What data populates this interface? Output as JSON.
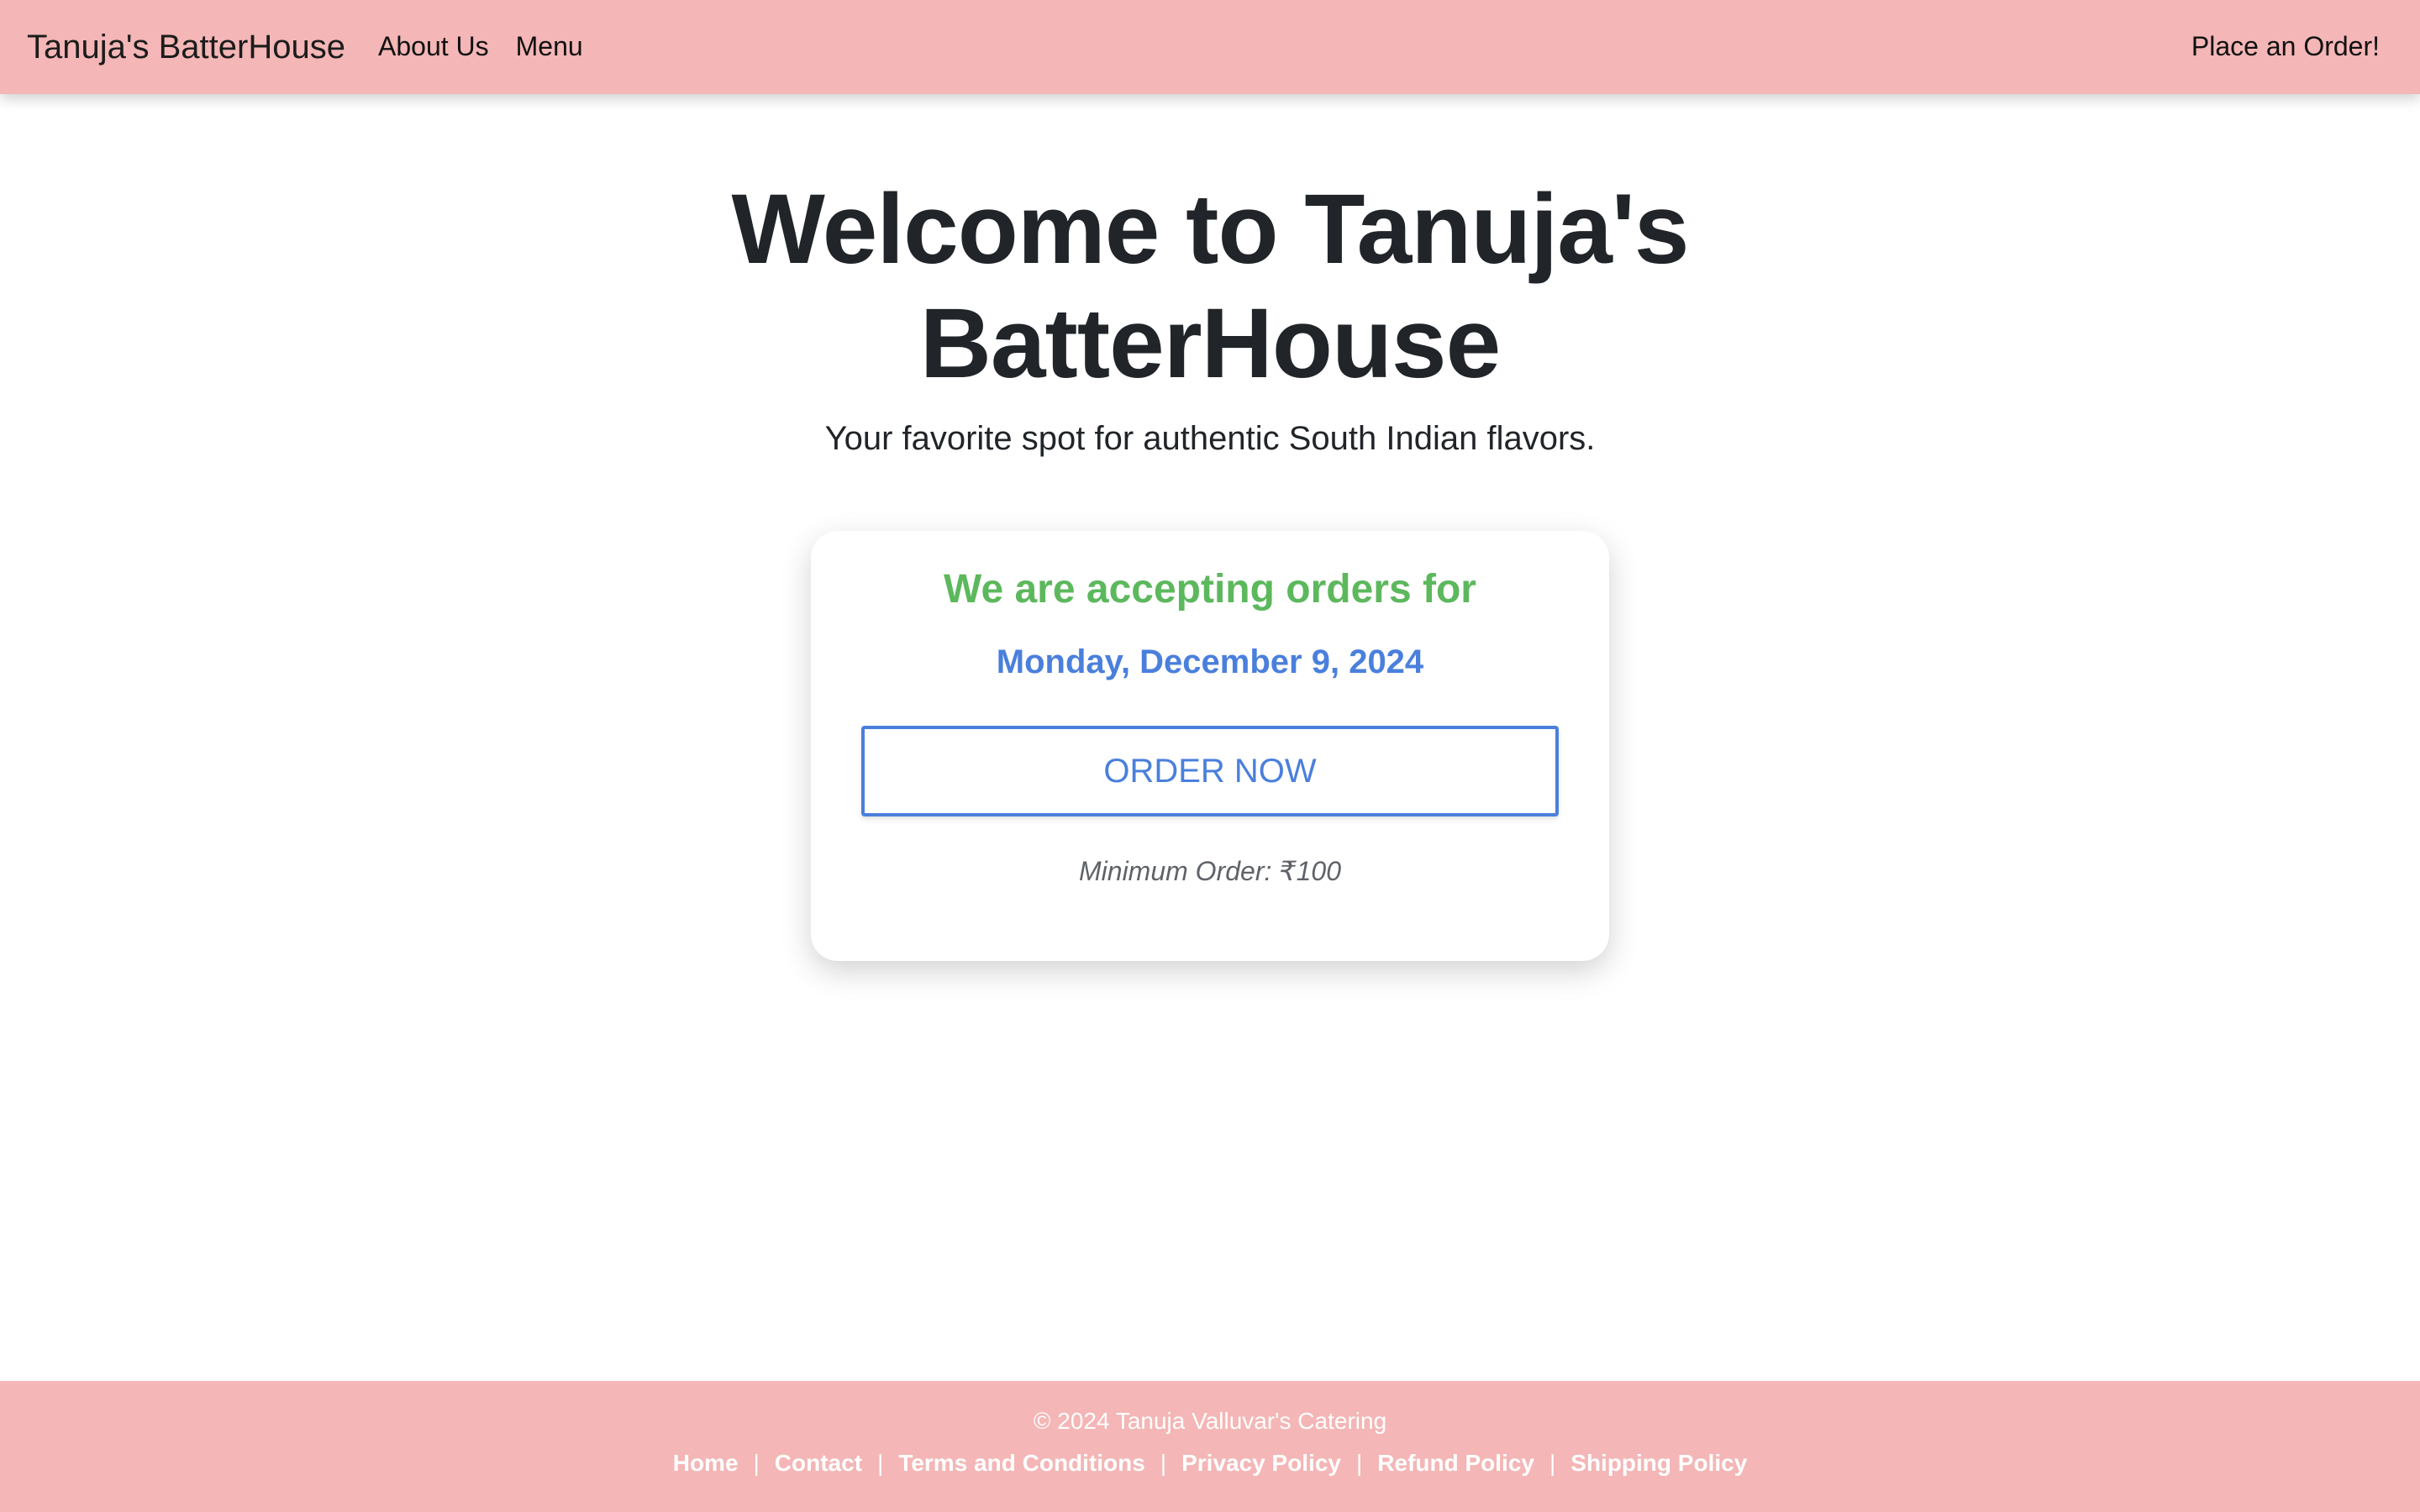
{
  "navbar": {
    "brand": "Tanuja's BatterHouse",
    "links": [
      {
        "label": "About Us"
      },
      {
        "label": "Menu"
      }
    ],
    "order_link": "Place an Order!"
  },
  "hero": {
    "title_line1": "Welcome to Tanuja's",
    "title_line2": "BatterHouse",
    "subtitle": "Your favorite spot for authentic South Indian flavors."
  },
  "order_card": {
    "heading": "We are accepting orders for",
    "date": "Monday, December 9, 2024",
    "button_label": "ORDER NOW",
    "minimum_order": "Minimum Order: ₹100"
  },
  "footer": {
    "copyright": "© 2024 Tanuja Valluvar's Catering",
    "links": [
      {
        "label": "Home"
      },
      {
        "label": "Contact"
      },
      {
        "label": "Terms and Conditions"
      },
      {
        "label": "Privacy Policy"
      },
      {
        "label": "Refund Policy"
      },
      {
        "label": "Shipping Policy"
      }
    ],
    "separator": "|"
  },
  "colors": {
    "navbar_bg": "#f4b6b6",
    "heading_green": "#5cb85c",
    "accent_blue": "#4a7fdc",
    "text_dark": "#212529"
  }
}
